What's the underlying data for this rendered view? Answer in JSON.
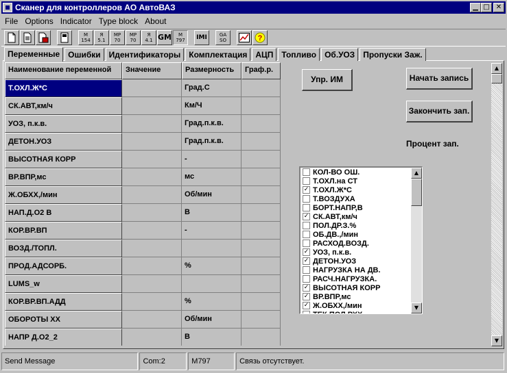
{
  "window": {
    "title": "Сканер для  контроллеров АО АвтоВАЗ"
  },
  "menu": [
    {
      "label": "File"
    },
    {
      "label": "Options"
    },
    {
      "label": "Indicator"
    },
    {
      "label": "Type block"
    },
    {
      "label": "About"
    }
  ],
  "toolbar": {
    "buttons": [
      {
        "icon": "new-file-icon",
        "line1": "",
        "line2": ""
      },
      {
        "icon": "open-file-icon",
        "line1": "",
        "line2": ""
      },
      {
        "icon": "save-file-icon",
        "line1": "",
        "line2": ""
      },
      {
        "icon": "device-icon",
        "line1": "",
        "line2": ""
      },
      {
        "icon": "mode-icon",
        "line1": "M",
        "line2": "154"
      },
      {
        "icon": "mode-icon",
        "line1": "Я",
        "line2": "5.1"
      },
      {
        "icon": "mode-icon",
        "line1": "MP",
        "line2": "70"
      },
      {
        "icon": "mode-icon",
        "line1": "MP",
        "line2": "70"
      },
      {
        "icon": "mode-icon",
        "line1": "Я",
        "line2": "4.1"
      },
      {
        "icon": "mode-icon",
        "line1": "GM",
        "line2": ""
      },
      {
        "icon": "mode-icon",
        "line1": "M",
        "line2": "797"
      },
      {
        "icon": "mode-icon",
        "line1": "IMI",
        "line2": ""
      },
      {
        "icon": "mode-icon",
        "line1": "GA",
        "line2": "SO"
      },
      {
        "icon": "chart-icon",
        "line1": "",
        "line2": ""
      },
      {
        "icon": "help-icon",
        "line1": "?",
        "line2": ""
      }
    ]
  },
  "tabs": [
    {
      "label": "Переменные",
      "active": true
    },
    {
      "label": "Ошибки"
    },
    {
      "label": "Идентификаторы"
    },
    {
      "label": "Комплектация"
    },
    {
      "label": "АЦП"
    },
    {
      "label": "Топливо"
    },
    {
      "label": "Об.УОЗ"
    },
    {
      "label": "Пропуски Заж."
    }
  ],
  "grid": {
    "headers": [
      "Наименование переменной",
      "Значение",
      "Размерность",
      "Граф.р."
    ],
    "rows": [
      {
        "name": "Т.ОХЛ.Ж*С",
        "value": "",
        "unit": "Град.С",
        "graph": ""
      },
      {
        "name": "СК.АВТ,км/ч",
        "value": "",
        "unit": "Км/Ч",
        "graph": ""
      },
      {
        "name": "УОЗ, п.к.в.",
        "value": "",
        "unit": "Град.п.к.в.",
        "graph": ""
      },
      {
        "name": "ДЕТОН.УОЗ",
        "value": "",
        "unit": "Град.п.к.в.",
        "graph": ""
      },
      {
        "name": "ВЫСОТНАЯ КОРР",
        "value": "",
        "unit": "-",
        "graph": ""
      },
      {
        "name": "ВР.ВПР,мс",
        "value": "",
        "unit": "мс",
        "graph": ""
      },
      {
        "name": "Ж.ОБХХ,/мин",
        "value": "",
        "unit": "Об/мин",
        "graph": ""
      },
      {
        "name": "НАП.Д.О2 В",
        "value": "",
        "unit": "В",
        "graph": ""
      },
      {
        "name": "КОР.ВР.ВП",
        "value": "",
        "unit": "-",
        "graph": ""
      },
      {
        "name": "ВОЗД./ТОПЛ.",
        "value": "",
        "unit": "",
        "graph": ""
      },
      {
        "name": "ПРОД.АДСОРБ.",
        "value": "",
        "unit": "%",
        "graph": ""
      },
      {
        "name": "LUMS_w",
        "value": "",
        "unit": "",
        "graph": ""
      },
      {
        "name": "КОР.ВР.ВП.АДД",
        "value": "",
        "unit": "%",
        "graph": ""
      },
      {
        "name": "ОБОРОТЫ ХХ",
        "value": "",
        "unit": "Об/мин",
        "graph": ""
      },
      {
        "name": "НАПР Д.О2_2",
        "value": "",
        "unit": "В",
        "graph": ""
      }
    ]
  },
  "buttons": {
    "upr_im": "Упр. ИМ",
    "start_record": "Начать запись",
    "stop_record": "Закончить зап.",
    "percent_label": "Процент зап."
  },
  "checklist": [
    {
      "label": "КОЛ-ВО ОШ.",
      "checked": false
    },
    {
      "label": "Т.ОХЛ.на СТ",
      "checked": false
    },
    {
      "label": "Т.ОХЛ.Ж*С",
      "checked": true
    },
    {
      "label": "Т.ВОЗДУХА",
      "checked": false
    },
    {
      "label": "БОРТ.НАПР,В",
      "checked": false
    },
    {
      "label": "СК.АВТ,км/ч",
      "checked": true
    },
    {
      "label": "ПОЛ.ДР.З.%",
      "checked": false
    },
    {
      "label": "ОБ.ДВ.,/мин",
      "checked": false
    },
    {
      "label": "РАСХОД.ВОЗД.",
      "checked": false
    },
    {
      "label": "УОЗ, п.к.в.",
      "checked": true
    },
    {
      "label": "ДЕТОН.УОЗ",
      "checked": true
    },
    {
      "label": "НАГРУЗКА НА ДВ.",
      "checked": false
    },
    {
      "label": "РАСЧ.НАГРУЗКА.",
      "checked": false
    },
    {
      "label": "ВЫСОТНАЯ КОРР",
      "checked": true
    },
    {
      "label": "ВР.ВПР,мс",
      "checked": true
    },
    {
      "label": "Ж.ОБХХ,/мин",
      "checked": true
    },
    {
      "label": "ТЕК.ПОЛ.РХХ",
      "checked": false
    }
  ],
  "status": {
    "message": "Send Message",
    "port": "Com:2",
    "model": "M797",
    "connection": "Связь отсутствует."
  },
  "colors": {
    "title_bg": "#000080",
    "selected_cell": "#000080"
  }
}
